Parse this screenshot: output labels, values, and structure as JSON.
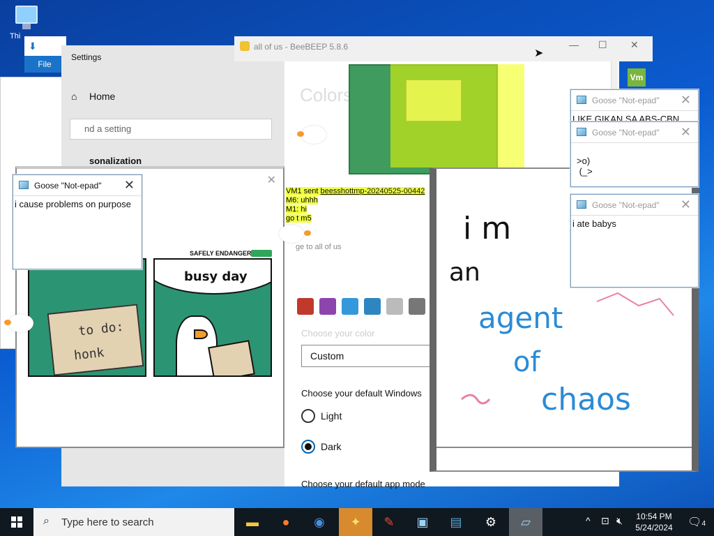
{
  "desktop": {
    "icon_label": "Thi"
  },
  "explorer": {
    "file_tab": "File"
  },
  "settings": {
    "window_title": "Settings",
    "home_label": "Home",
    "search_placeholder": "nd a setting",
    "section_label": "sonalization",
    "page_heading": "Colors",
    "choose_color_label": "Choose your color",
    "color_dropdown_value": "Custom",
    "choose_windows_mode": "Choose your default Windows",
    "light_label": "Light",
    "dark_label": "Dark",
    "app_mode_label": "Choose your default app mode"
  },
  "beebeep": {
    "window_title": "all of us - BeeBEEP 5.8.6",
    "vm_icon": "Vm",
    "chat": {
      "line1_prefix": "VM1 sent ",
      "line1_link": "beesshottmp-20240525-00442",
      "line2": "M6: uhhh",
      "line3": "M1: hi",
      "line4": "go t    m5",
      "send_to": "ge to all of us"
    }
  },
  "comic": {
    "brand": "SAFELY ENDANGERED",
    "panel1_todo": "to do:",
    "panel1_honk": "honk",
    "panel2_bubble": "busy day"
  },
  "notepads": [
    {
      "title": "Goose \"Not-epad\"",
      "body": "i cause problems on purpose",
      "dimmed": false
    },
    {
      "title": "Goose \"Not-epad\"",
      "body": "LIKE GIKAN SA ABS-CBN",
      "dimmed": true
    },
    {
      "title": "Goose \"Not-epad\"",
      "body": ">o)\n (_>",
      "dimmed": true
    },
    {
      "title": "Goose \"Not-epad\"",
      "body": "i ate babys",
      "dimmed": true
    }
  ],
  "drawing": {
    "line1": "i  m",
    "line2": "an",
    "line3": "agent",
    "line4": "of",
    "line5": "chaos"
  },
  "taskbar": {
    "search_placeholder": "Type here to search",
    "time": "10:54 PM",
    "date": "5/24/2024",
    "notification_count": "4"
  },
  "colors": {
    "accent": "#0063b1",
    "taskbar": "#101820",
    "beebeep_active": "#d88a2e",
    "comic_green": "#2b9473",
    "highlight_yellow": "#f0ff44"
  }
}
